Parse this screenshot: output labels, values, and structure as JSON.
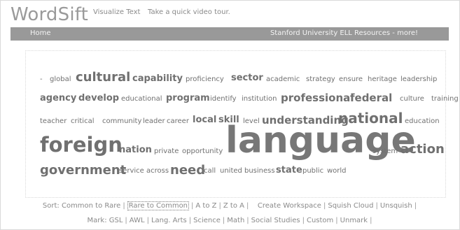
{
  "header": {
    "logo": "WordSift",
    "tagline": "Visualize Text",
    "tour_link": "Take a quick video tour."
  },
  "nav": {
    "home": "Home",
    "resources": "Stanford University ELL Resources - more!"
  },
  "cloud": {
    "words": [
      {
        "text": "-",
        "size": "s1"
      },
      {
        "text": "global",
        "size": "s1"
      },
      {
        "text": "cultural",
        "size": "s5"
      },
      {
        "text": "capability",
        "size": "s3"
      },
      {
        "text": "proficiency",
        "size": "s1"
      },
      {
        "text": "sector",
        "size": "s3"
      },
      {
        "text": "academic",
        "size": "s1"
      },
      {
        "text": "strategy",
        "size": "s1"
      },
      {
        "text": "ensure",
        "size": "s1"
      },
      {
        "text": "heritage",
        "size": "s1"
      },
      {
        "text": "leadership",
        "size": "s1"
      },
      {
        "text": "agency",
        "size": "s3"
      },
      {
        "text": "develop",
        "size": "s3"
      },
      {
        "text": "educational",
        "size": "s1"
      },
      {
        "text": "program",
        "size": "s3"
      },
      {
        "text": "identify",
        "size": "s1"
      },
      {
        "text": "institution",
        "size": "s1"
      },
      {
        "text": "professional",
        "size": "s4"
      },
      {
        "text": "federal",
        "size": "s4"
      },
      {
        "text": "culture",
        "size": "s1"
      },
      {
        "text": "training",
        "size": "s1"
      },
      {
        "text": "teacher",
        "size": "s1"
      },
      {
        "text": "critical",
        "size": "s1"
      },
      {
        "text": "community",
        "size": "s1"
      },
      {
        "text": "leader",
        "size": "s1"
      },
      {
        "text": "career",
        "size": "s1"
      },
      {
        "text": "local",
        "size": "s3"
      },
      {
        "text": "skill",
        "size": "s3"
      },
      {
        "text": "level",
        "size": "s1"
      },
      {
        "text": "understanding",
        "size": "s4"
      },
      {
        "text": "national",
        "size": "s6"
      },
      {
        "text": "education",
        "size": "s1"
      },
      {
        "text": "foreign",
        "size": "s7"
      },
      {
        "text": "nation",
        "size": "s3"
      },
      {
        "text": "private",
        "size": "s1"
      },
      {
        "text": "opportunity",
        "size": "s1"
      },
      {
        "text": "language",
        "size": "s8"
      },
      {
        "text": "system",
        "size": "s1"
      },
      {
        "text": "action",
        "size": "s5"
      },
      {
        "text": "government",
        "size": "s5"
      },
      {
        "text": "service",
        "size": "s1"
      },
      {
        "text": "across",
        "size": "s1"
      },
      {
        "text": "need",
        "size": "s5"
      },
      {
        "text": "call",
        "size": "s1"
      },
      {
        "text": "united",
        "size": "s1"
      },
      {
        "text": "business",
        "size": "s1"
      },
      {
        "text": "state",
        "size": "s3"
      },
      {
        "text": "public",
        "size": "s1"
      },
      {
        "text": "world",
        "size": "s1"
      }
    ]
  },
  "sort": {
    "label": "Sort:",
    "common_to_rare": "Common to Rare",
    "rare_to_common": "Rare to Common",
    "a_to_z": "A to Z",
    "z_to_a": "Z to A",
    "create_workspace": "Create Workspace",
    "squish_cloud": "Squish Cloud",
    "unsquish": "Unsquish"
  },
  "mark": {
    "label": "Mark:",
    "gsl": "GSL",
    "awl": "AWL",
    "lang_arts": "Lang. Arts",
    "science": "Science",
    "math": "Math",
    "social_studies": "Social Studies",
    "custom": "Custom",
    "unmark": "Unmark"
  }
}
